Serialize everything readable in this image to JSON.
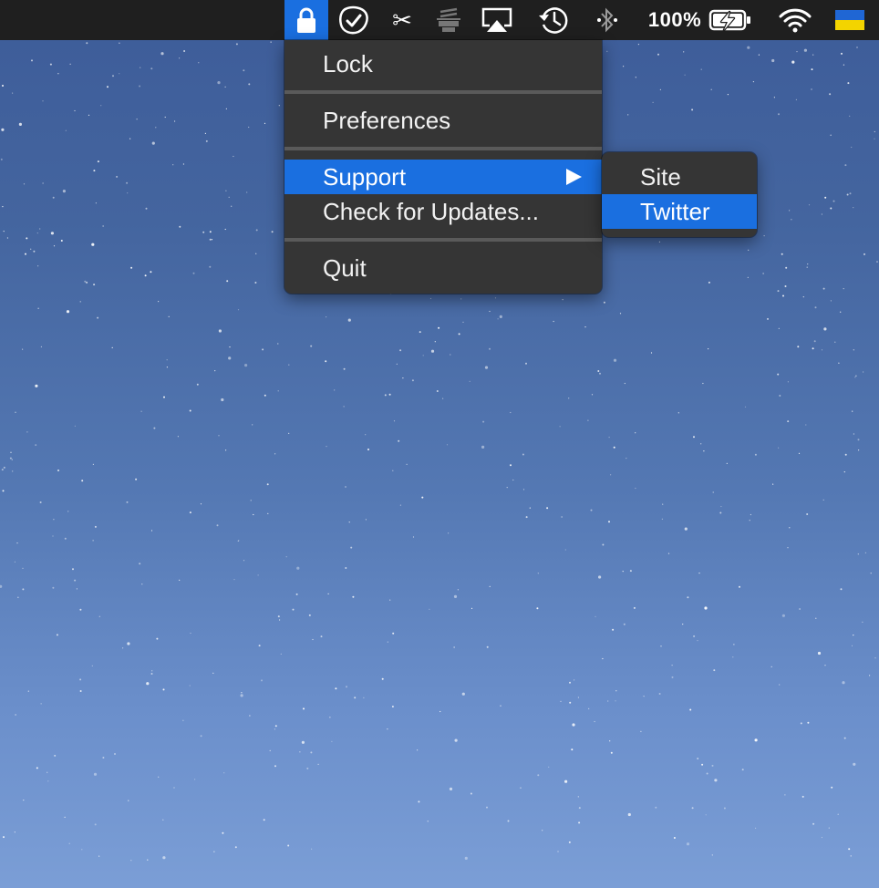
{
  "menubar": {
    "icons": {
      "lock": "lock-icon",
      "check": "checkmark-badge-icon",
      "scissors": "scissors-icon",
      "stamp": "stamp-icon",
      "airplay": "airplay-icon",
      "time_machine": "time-machine-icon",
      "bluetooth": "bluetooth-icon",
      "battery": "battery-charging-icon",
      "wifi": "wifi-icon",
      "flag": "ukraine-flag-icon"
    },
    "scissors_glyph": "✂",
    "battery_percent": "100%"
  },
  "main_menu": {
    "items": [
      {
        "label": "Lock"
      },
      {
        "label": "Preferences"
      },
      {
        "label": "Support",
        "selected": true,
        "has_submenu": true
      },
      {
        "label": "Check for Updates..."
      },
      {
        "label": "Quit"
      }
    ]
  },
  "support_submenu": {
    "items": [
      {
        "label": "Site"
      },
      {
        "label": "Twitter",
        "selected": true
      }
    ]
  },
  "colors": {
    "menubar_bg": "#1f1f1f",
    "menu_bg": "#353535",
    "highlight": "#1a6fe0",
    "separator": "#5a5a5a",
    "flag_blue": "#1f66d4",
    "flag_yellow": "#f3d400"
  }
}
